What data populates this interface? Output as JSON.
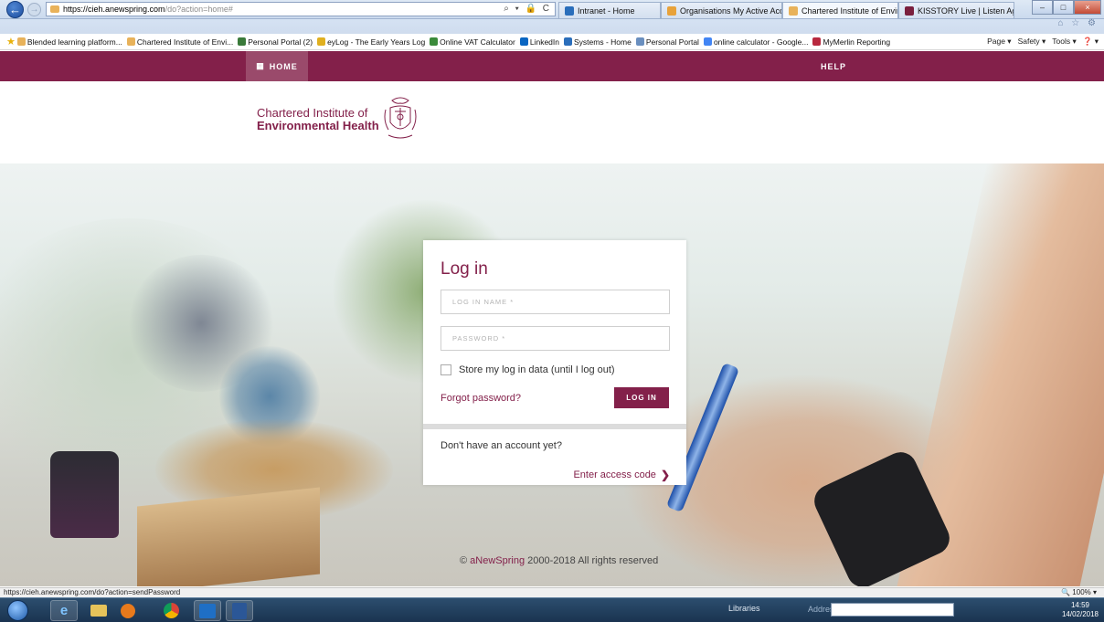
{
  "browser": {
    "url_lead": "https://cieh.anewspring.com",
    "url_path": "/do?action=home#",
    "url_tools": "⌕ ▾ 🔒 C",
    "tabs": [
      {
        "label": "Intranet - Home",
        "color": "#2a6ebb"
      },
      {
        "label": "Organisations My Active Acco...",
        "color": "#e8a23a"
      },
      {
        "label": "Chartered Institute of Envir...",
        "color": "#e8b25a",
        "active": true
      },
      {
        "label": "KISSTORY Live | Listen Again | ...",
        "color": "#7a1f3d"
      }
    ],
    "tab_close": "×",
    "window_controls": {
      "minimize": "–",
      "maximize": "□",
      "close": "×"
    },
    "browser_icons": "⌂ ☆ ⚙",
    "favorites": [
      {
        "label": "Blended learning platform...",
        "color": "#e8b25a"
      },
      {
        "label": "Chartered Institute of Envi...",
        "color": "#e8b25a"
      },
      {
        "label": "Personal Portal (2)",
        "color": "#3a7a3a"
      },
      {
        "label": "eyLog - The Early Years Log",
        "color": "#e0b020"
      },
      {
        "label": "Online VAT Calculator",
        "color": "#3a8a3a"
      },
      {
        "label": "LinkedIn",
        "color": "#0a66c2"
      },
      {
        "label": "Systems - Home",
        "color": "#2a6ebb"
      },
      {
        "label": "Personal Portal",
        "color": "#6a8fbf"
      },
      {
        "label": "online calculator - Google...",
        "color": "#4285f4"
      },
      {
        "label": "MyMerlin Reporting",
        "color": "#b8283e"
      }
    ],
    "command_bar": [
      "Page ▾",
      "Safety ▾",
      "Tools ▾",
      "❓ ▾"
    ],
    "status_url": "https://cieh.anewspring.com/do?action=sendPassword",
    "zoom": "🔍 100% ▾"
  },
  "site": {
    "nav": {
      "home": "HOME",
      "help": "HELP"
    },
    "logo": {
      "line1": "Chartered Institute of",
      "line2": "Environmental Health"
    },
    "login": {
      "title": "Log in",
      "login_name_placeholder": "LOG IN NAME *",
      "password_placeholder": "PASSWORD *",
      "remember_label": "Store my log in data (until I log out)",
      "forgot_password": "Forgot password?",
      "login_button": "LOG IN",
      "no_account": "Don't have an account yet?",
      "access_code": "Enter access code",
      "access_chevron": "❯"
    },
    "copyright": {
      "prefix": "© ",
      "brand": "aNewSpring",
      "suffix": " 2000-2018 All rights reserved"
    }
  },
  "taskbar": {
    "libraries": "Libraries",
    "address_label": "Address",
    "time": "14:59",
    "date": "14/02/2018"
  },
  "colors": {
    "brand": "#83204a",
    "nav_active": "#9a4a6b"
  }
}
